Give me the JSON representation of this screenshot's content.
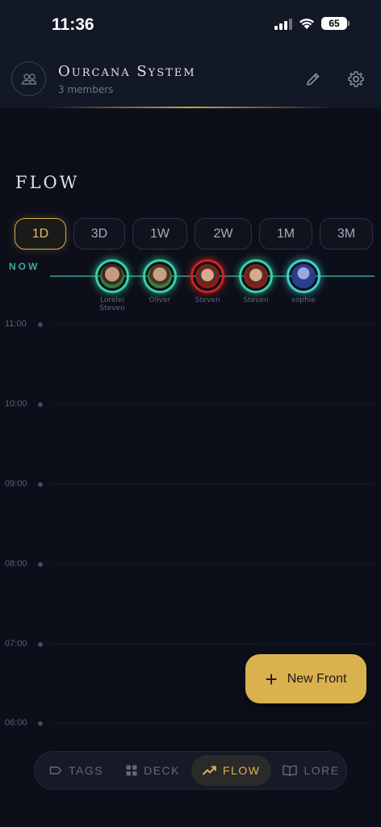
{
  "status_bar": {
    "time": "11:36",
    "battery": "65"
  },
  "header": {
    "system_name": "Ourcana System",
    "member_count": "3 members",
    "icons": {
      "avatar": "people-icon",
      "edit": "pencil-icon",
      "settings": "gear-icon"
    }
  },
  "flow": {
    "title": "FLOW",
    "ranges": [
      {
        "label": "1D",
        "active": true
      },
      {
        "label": "3D",
        "active": false
      },
      {
        "label": "1W",
        "active": false
      },
      {
        "label": "2W",
        "active": false
      },
      {
        "label": "1M",
        "active": false
      },
      {
        "label": "3M",
        "active": false
      }
    ],
    "now_label": "NOW",
    "fronts": [
      {
        "name": "Lorelei\nSteven",
        "ring": "green",
        "ring_color": "#37d1a6"
      },
      {
        "name": "Oliver",
        "ring": "green",
        "ring_color": "#37d1a6"
      },
      {
        "name": "Steven",
        "ring": "red",
        "ring_color": "#c8261f"
      },
      {
        "name": "Steven",
        "ring": "green",
        "ring_color": "#37d1a6"
      },
      {
        "name": "sophie",
        "ring": "blue",
        "ring_color": "#3fd0c7"
      }
    ],
    "hours": [
      "11:00",
      "10:00",
      "09:00",
      "08:00",
      "07:00",
      "06:00"
    ]
  },
  "fab": {
    "label": "New Front",
    "icon": "plus-icon"
  },
  "nav": {
    "items": [
      {
        "label": "TAGS",
        "icon": "tag-icon",
        "active": false
      },
      {
        "label": "DECK",
        "icon": "grid-icon",
        "active": false
      },
      {
        "label": "FLOW",
        "icon": "trend-icon",
        "active": true
      },
      {
        "label": "LORE",
        "icon": "book-icon",
        "active": false
      }
    ]
  },
  "colors": {
    "accent": "#d9b24e",
    "background": "#0c0f1a",
    "now": "#3ea894"
  }
}
